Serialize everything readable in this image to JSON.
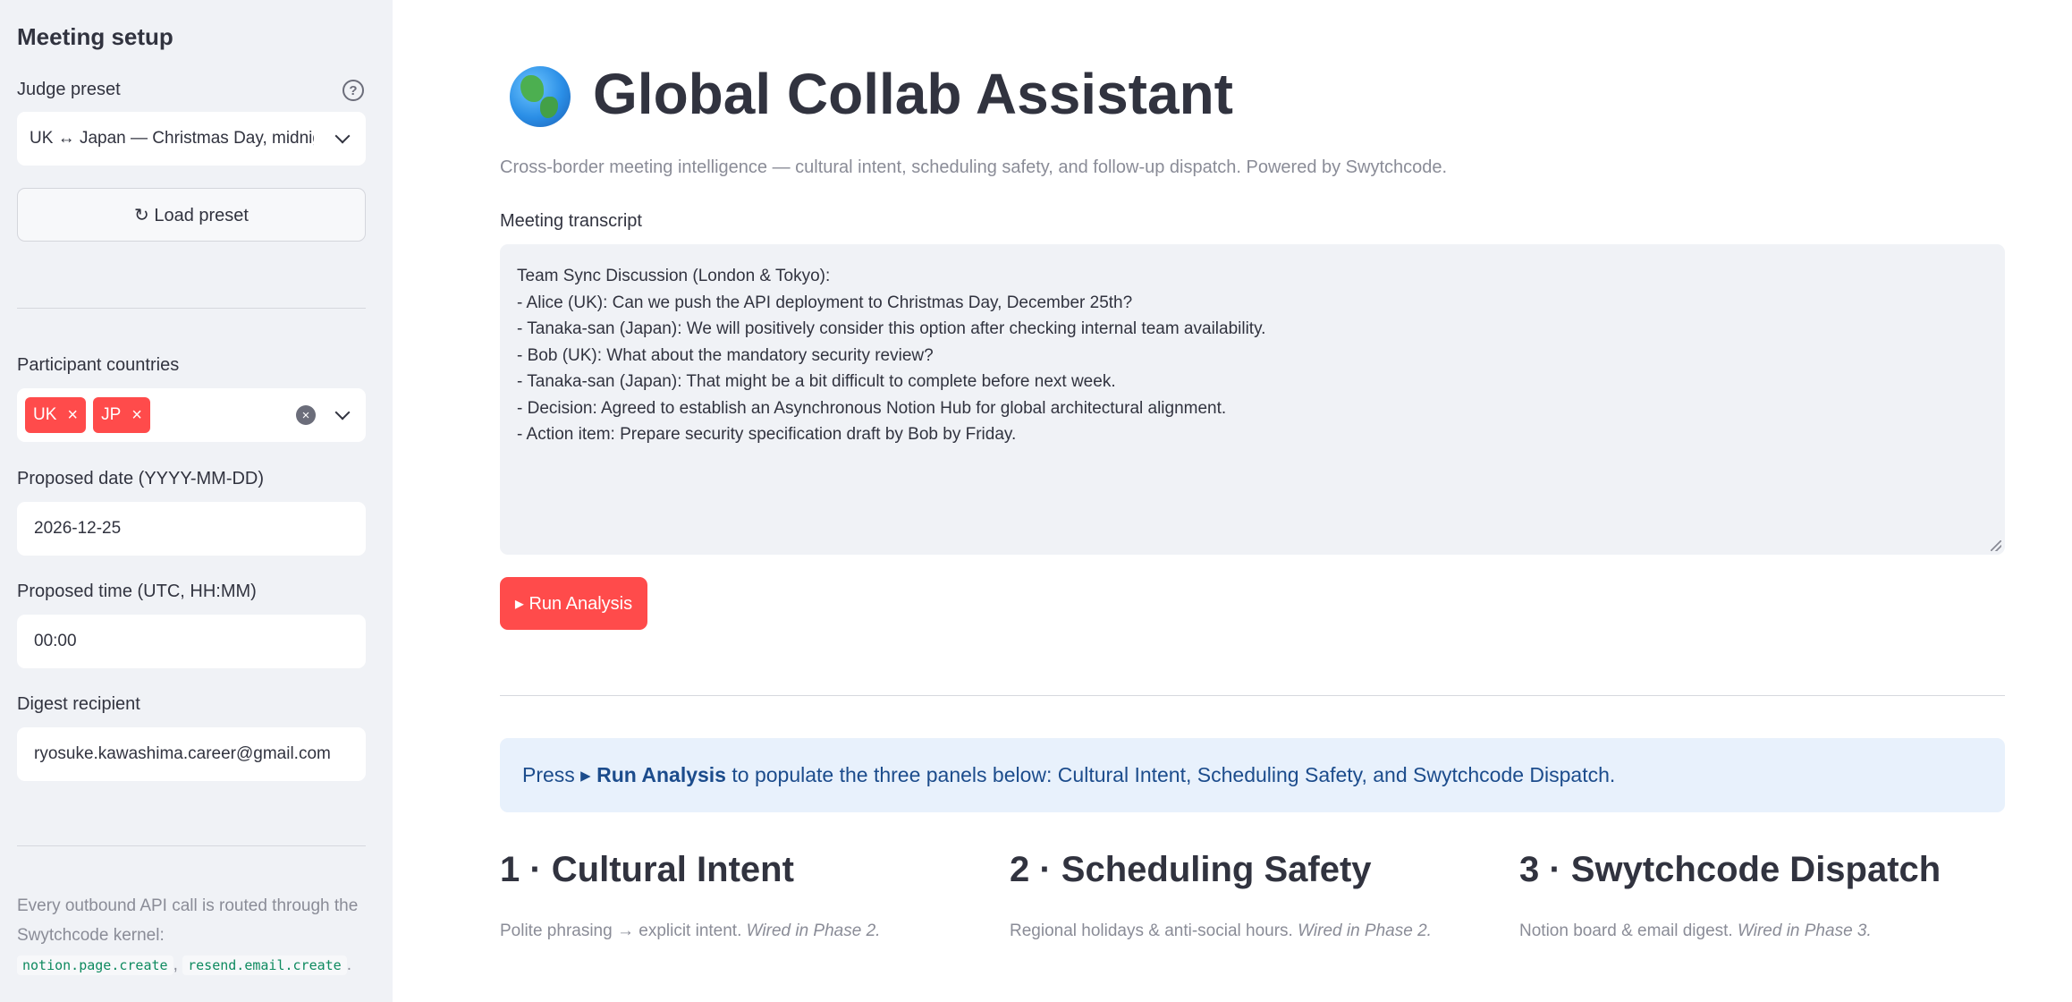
{
  "sidebar": {
    "title": "Meeting setup",
    "judge_preset": {
      "label": "Judge preset",
      "value": "UK ↔ Japan — Christmas Day, midnight"
    },
    "load_preset_label": "↻ Load preset",
    "participant_countries": {
      "label": "Participant countries",
      "tags": [
        "UK",
        "JP"
      ]
    },
    "proposed_date": {
      "label": "Proposed date (YYYY-MM-DD)",
      "value": "2026-12-25"
    },
    "proposed_time": {
      "label": "Proposed time (UTC, HH:MM)",
      "value": "00:00"
    },
    "digest_recipient": {
      "label": "Digest recipient",
      "value": "ryosuke.kawashima.career@gmail.com"
    },
    "note": {
      "text": "Every outbound API call is routed through the Swytchcode kernel:",
      "code1": "notion.page.create",
      "sep": ",",
      "code2": "resend.email.create",
      "end": "."
    }
  },
  "main": {
    "title": "Global Collab Assistant",
    "subtitle": "Cross-border meeting intelligence — cultural intent, scheduling safety, and follow-up dispatch. Powered by Swytchcode.",
    "transcript_label": "Meeting transcript",
    "transcript_lines": [
      "Team Sync Discussion (London & Tokyo):",
      "- Alice (UK): Can we push the API deployment to Christmas Day, December 25th?",
      "- Tanaka-san (Japan): We will positively consider this option after checking internal team availability.",
      "- Bob (UK): What about the mandatory security review?",
      "- Tanaka-san (Japan): That might be a bit difficult to complete before next week.",
      "- Decision: Agreed to establish an Asynchronous Notion Hub for global architectural alignment.",
      "- Action item: Prepare security specification draft by Bob by Friday."
    ],
    "run_button_label": "▸ Run Analysis",
    "info": {
      "prefix": "Press ▸ ",
      "bold": "Run Analysis",
      "suffix": " to populate the three panels below: Cultural Intent, Scheduling Safety, and Swytchcode Dispatch."
    },
    "columns": [
      {
        "title": "1 · Cultural Intent",
        "desc": "Polite phrasing → explicit intent. ",
        "desc_italic": "Wired in Phase 2."
      },
      {
        "title": "2 · Scheduling Safety",
        "desc": "Regional holidays & anti-social hours. ",
        "desc_italic": "Wired in Phase 2."
      },
      {
        "title": "3 · Swytchcode Dispatch",
        "desc": "Notion board & email digest. ",
        "desc_italic": "Wired in Phase 3."
      }
    ]
  },
  "colors": {
    "accent": "#ff4b4b",
    "sidebar_bg": "#f0f2f6",
    "info_bg": "#e8f1fc",
    "info_text": "#1c4c8c"
  }
}
